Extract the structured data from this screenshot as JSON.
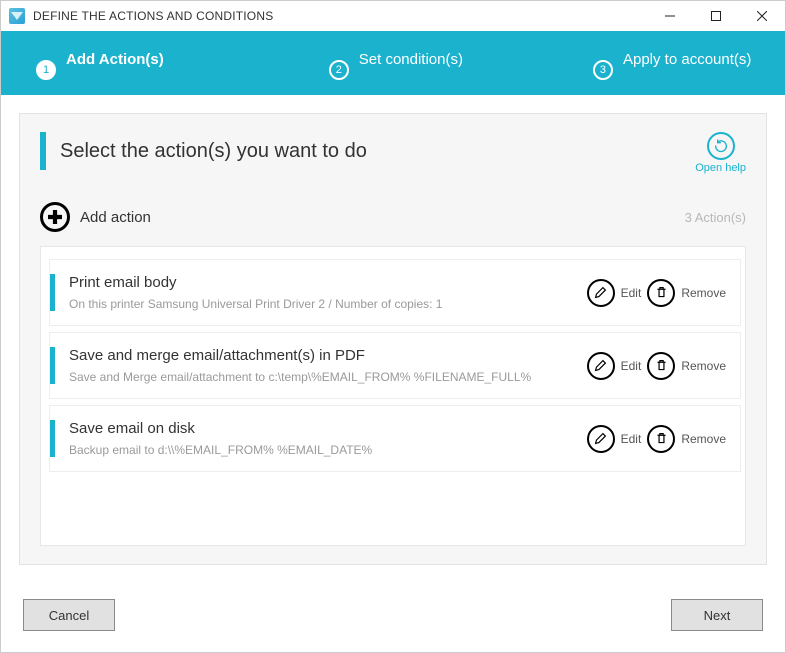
{
  "window": {
    "title": "DEFINE THE ACTIONS AND CONDITIONS"
  },
  "stepper": {
    "steps": [
      {
        "num": "1",
        "label": "Add Action(s)",
        "active": true
      },
      {
        "num": "2",
        "label": "Set condition(s)",
        "active": false
      },
      {
        "num": "3",
        "label": "Apply to account(s)",
        "active": false
      }
    ]
  },
  "header": {
    "title": "Select the action(s) you want to do",
    "help_label": "Open help"
  },
  "add": {
    "label": "Add action",
    "count_text": "3  Action(s)"
  },
  "actions": [
    {
      "title": "Print email body",
      "subtitle": "On this printer Samsung Universal Print Driver 2 / Number of copies: 1",
      "edit_label": "Edit",
      "remove_label": "Remove"
    },
    {
      "title": "Save and merge email/attachment(s) in PDF",
      "subtitle": "Save and Merge email/attachment to c:\\temp\\%EMAIL_FROM% %FILENAME_FULL%",
      "edit_label": "Edit",
      "remove_label": "Remove"
    },
    {
      "title": "Save email on disk",
      "subtitle": "Backup email to d:\\\\%EMAIL_FROM% %EMAIL_DATE%",
      "edit_label": "Edit",
      "remove_label": "Remove"
    }
  ],
  "footer": {
    "cancel": "Cancel",
    "next": "Next"
  }
}
